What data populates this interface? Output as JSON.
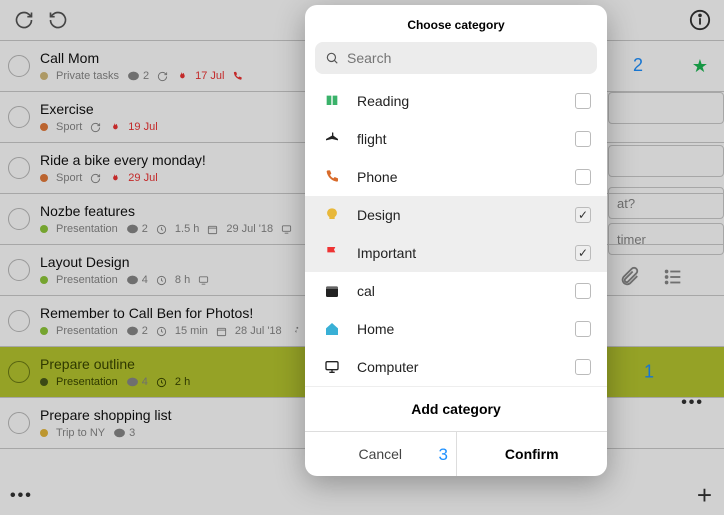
{
  "modal": {
    "title": "Choose category",
    "search_placeholder": "Search",
    "add_label": "Add category",
    "cancel_label": "Cancel",
    "confirm_label": "Confirm",
    "categories": [
      {
        "label": "Reading",
        "icon": "book",
        "color": "#3ab26a",
        "selected": false
      },
      {
        "label": "flight",
        "icon": "plane",
        "color": "#222",
        "selected": false
      },
      {
        "label": "Phone",
        "icon": "phone",
        "color": "#d86b2b",
        "selected": false
      },
      {
        "label": "Design",
        "icon": "bulb",
        "color": "#e8b83a",
        "selected": true
      },
      {
        "label": "Important",
        "icon": "flag",
        "color": "#e33",
        "selected": true
      },
      {
        "label": "cal",
        "icon": "calendar",
        "color": "#222",
        "selected": false
      },
      {
        "label": "Home",
        "icon": "home",
        "color": "#39b0d6",
        "selected": false
      },
      {
        "label": "Computer",
        "icon": "monitor",
        "color": "#222",
        "selected": false
      }
    ]
  },
  "helpers": {
    "n1": "1",
    "n2": "2",
    "n3": "3"
  },
  "right": {
    "option1": "at?",
    "option2": "timer"
  },
  "tasks": [
    {
      "title": "Call Mom",
      "project": "Private tasks",
      "dot": "beige",
      "chips": [
        "comments:2",
        "recur",
        "fire",
        "17 Jul",
        "phone"
      ],
      "red_date": true
    },
    {
      "title": "Exercise",
      "project": "Sport",
      "dot": "orange",
      "chips": [
        "recur",
        "fire",
        "19 Jul"
      ],
      "red_date": true
    },
    {
      "title": "Ride a bike every monday!",
      "project": "Sport",
      "dot": "orange",
      "chips": [
        "recur",
        "fire",
        "29 Jul"
      ],
      "red_date": true
    },
    {
      "title": "Nozbe features",
      "project": "Presentation",
      "dot": "green",
      "chips": [
        "comments:2",
        "clock",
        "1.5 h",
        "cal",
        "29 Jul '18",
        "monitor"
      ]
    },
    {
      "title": "Layout Design",
      "project": "Presentation",
      "dot": "green",
      "chips": [
        "comments:4",
        "clock",
        "8 h",
        "monitor"
      ]
    },
    {
      "title": "Remember to Call Ben for Photos!",
      "project": "Presentation",
      "dot": "green",
      "chips": [
        "comments:2",
        "clock",
        "15 min",
        "cal",
        "28 Jul '18",
        "run"
      ]
    },
    {
      "title": "Prepare outline",
      "project": "Presentation",
      "dot": "dark",
      "chips": [
        "comments:4",
        "clock",
        "2 h"
      ],
      "selected": true
    },
    {
      "title": "Prepare shopping list",
      "project": "Trip to NY",
      "dot": "yellow",
      "chips": [
        "comments:3"
      ]
    }
  ]
}
